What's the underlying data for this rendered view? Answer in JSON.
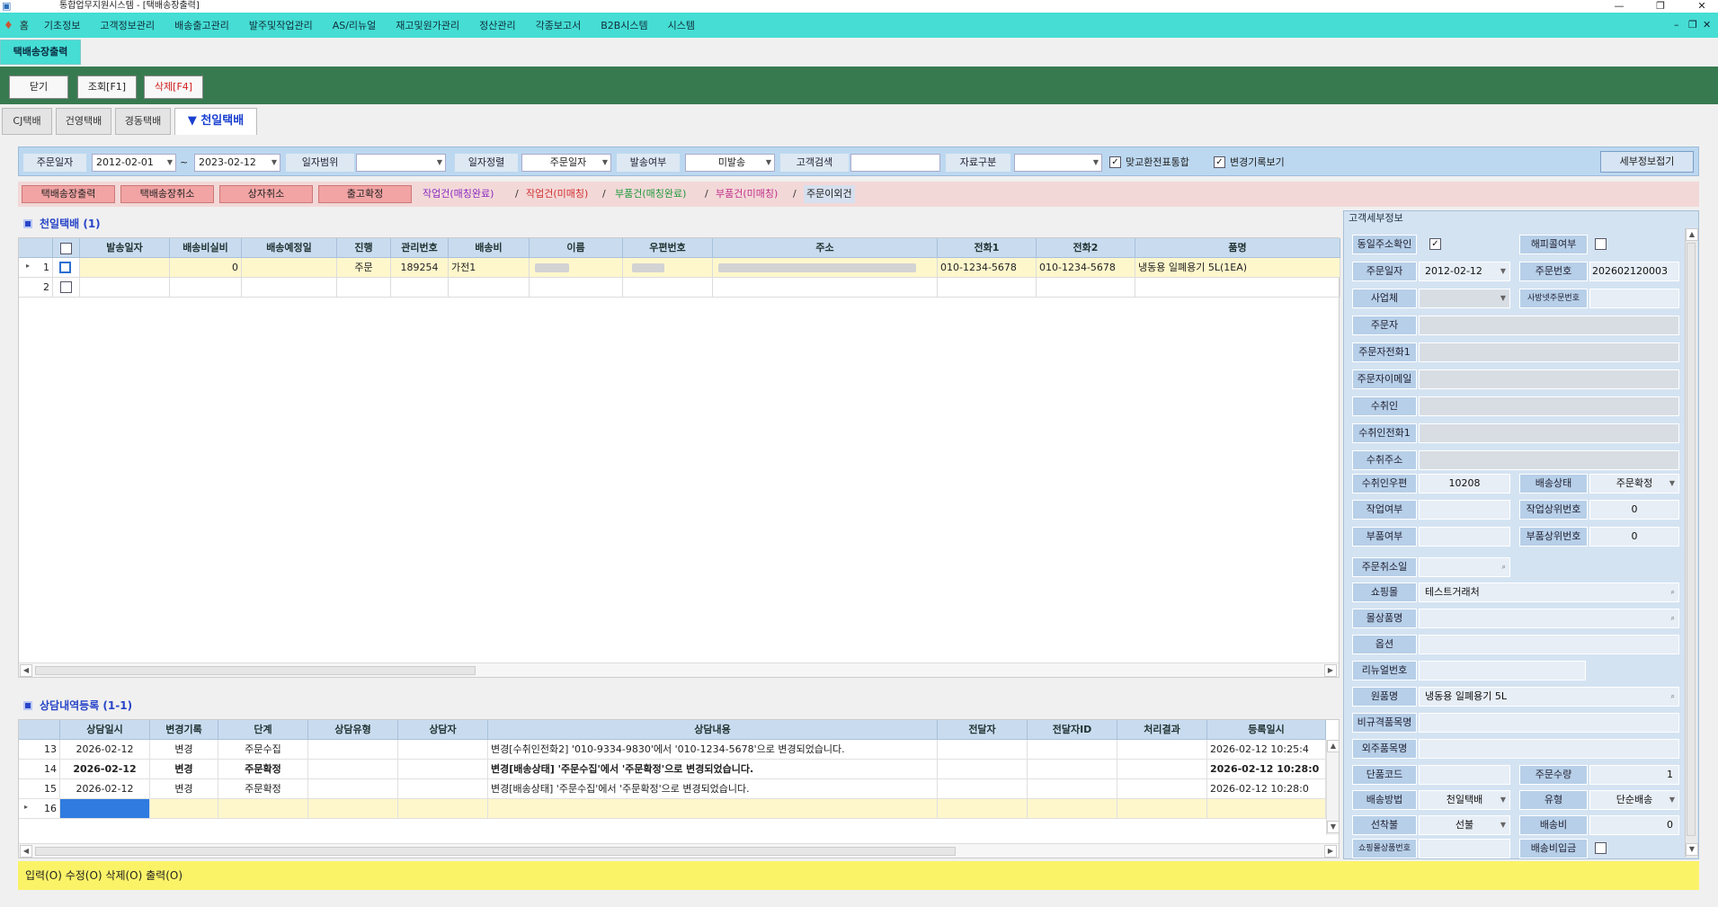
{
  "window": {
    "title": "통합업무지원시스템 - [택배송장출력]"
  },
  "menu": {
    "items": [
      "기초정보",
      "고객정보관리",
      "배송출고관리",
      "발주및작업관리",
      "AS/리뉴얼",
      "재고및원가관리",
      "정산관리",
      "각종보고서",
      "B2B시스템",
      "시스템"
    ]
  },
  "doc_tab": "택배송장출력",
  "toolbar": {
    "close": "닫기",
    "search": "조회[F1]",
    "delete": "삭제[F4]"
  },
  "carrier_tabs": [
    "CJ택배",
    "건영택배",
    "경동택배",
    "▼ 천일택배"
  ],
  "filters": {
    "order_date_label": "주문일자",
    "date_from": "2012-02-01",
    "tilde": "~",
    "date_to": "2023-02-12",
    "date_range_label": "일자범위",
    "date_range_value": "",
    "date_sort_label": "일자정렬",
    "date_sort_value": "주문일자",
    "shipped_label": "발송여부",
    "shipped_value": "미발송",
    "customer_search_label": "고객검색",
    "customer_search_value": "",
    "data_type_label": "자료구분",
    "data_type_value": "",
    "exchange_label": "맞교환전표통합",
    "history_label": "변경기록보기",
    "detail_button": "세부정보접기"
  },
  "actions": {
    "print_invoice": "택배송장출력",
    "cancel_invoice": "택배송장취소",
    "cancel_box": "상자취소",
    "confirm_release": "출고확정",
    "links": [
      "작업건(매칭완료)",
      "/",
      "작업건(미매칭)",
      "/",
      "부품건(매칭완료)",
      "/",
      "부품건(미매칭)",
      "/",
      "주문이외건"
    ]
  },
  "upper_group": {
    "title": "천일택배 (1)"
  },
  "upper_table": {
    "columns": [
      "발송일자",
      "배송비실비",
      "배송예정일",
      "진행",
      "관리번호",
      "배송비",
      "이름",
      "우편번호",
      "주소",
      "전화1",
      "전화2",
      "품명"
    ],
    "rows": [
      {
        "num": "1",
        "send_date": "",
        "actual_fee": "0",
        "eta": "",
        "progress": "주문",
        "mgmt_no": "189254",
        "fee": "가전1",
        "name": "",
        "zip": "",
        "addr": "",
        "tel1": "010-1234-5678",
        "tel2": "010-1234-5678",
        "item": "냉동용 일폐용기 5L(1EA)"
      },
      {
        "num": "2",
        "send_date": "",
        "actual_fee": "",
        "eta": "",
        "progress": "",
        "mgmt_no": "",
        "fee": "",
        "name": "",
        "zip": "",
        "addr": "",
        "tel1": "",
        "tel2": "",
        "item": ""
      }
    ]
  },
  "lower_group": {
    "title": "상담내역등록 (1-1)"
  },
  "lower_table": {
    "columns": [
      "상담일시",
      "변경기록",
      "단계",
      "상담유형",
      "상담자",
      "상담내용",
      "전달자",
      "전달자ID",
      "처리결과",
      "등록일시"
    ],
    "rows": [
      {
        "num": "13",
        "date": "2026-02-12",
        "change": "변경",
        "stage": "주문수집",
        "content": "변경[수취인전화2] '010-9334-9830'에서 '010-1234-5678'으로 변경되었습니다.",
        "reg": "2026-02-12 10:25:4"
      },
      {
        "num": "14",
        "date": "2026-02-12",
        "change": "변경",
        "stage": "주문확정",
        "content": "변경[배송상태] '주문수집'에서 '주문확정'으로 변경되었습니다.",
        "reg": "2026-02-12 10:28:0"
      },
      {
        "num": "15",
        "date": "2026-02-12",
        "change": "변경",
        "stage": "주문확정",
        "content": "변경[배송상태] '주문수집'에서 '주문확정'으로 변경되었습니다.",
        "reg": "2026-02-12 10:28:0"
      },
      {
        "num": "16",
        "date": "",
        "change": "",
        "stage": "",
        "content": "",
        "reg": ""
      }
    ]
  },
  "status_bar": "입력(O) 수정(O) 삭제(O) 출력(O)",
  "customer_panel": {
    "title": "고객세부정보",
    "same_addr": "동일주소확인",
    "happycall": "해피콜여부",
    "order_date_label": "주문일자",
    "order_date": "2012-02-12",
    "order_no_label": "주문번호",
    "order_no": "202602120003",
    "business_label": "사업체",
    "mall_order_no_label": "사방넷주문번호",
    "orderer_label": "주문자",
    "orderer_tel_label": "주문자전화1",
    "orderer_email_label": "주문자이메일",
    "receiver_label": "수취인",
    "receiver_tel_label": "수취인전화1",
    "receiver_addr_label": "수취주소",
    "receiver_zip_label": "수취인우편",
    "receiver_zip": "10208",
    "ship_status_label": "배송상태",
    "ship_status": "주문확정",
    "work_label": "작업여부",
    "work_parent_label": "작업상위번호",
    "work_parent": "0",
    "part_label": "부품여부",
    "part_parent_label": "부품상위번호",
    "part_parent": "0",
    "order_cancel_label": "주문취소일",
    "mall_label": "쇼핑몰",
    "mall": "테스트거래처",
    "mall_product_label": "몰상품명",
    "option_label": "옵션",
    "renewal_label": "리뉴얼번호",
    "original_label": "원품명",
    "original": "냉동용 일폐용기 5L",
    "nonstandard_label": "비규격품목명",
    "outsourced_label": "외주품목명",
    "item_code_label": "단품코드",
    "qty_label": "주문수량",
    "qty": "1",
    "ship_method_label": "배송방법",
    "ship_method": "천일택배",
    "type_label": "유형",
    "type": "단순배송",
    "prepay_label": "선착불",
    "prepay": "선불",
    "ship_fee_label": "배송비",
    "ship_fee": "0",
    "mall_product_no_label": "쇼핑몰상품번호",
    "fee_deposit_label": "배송비입금"
  }
}
